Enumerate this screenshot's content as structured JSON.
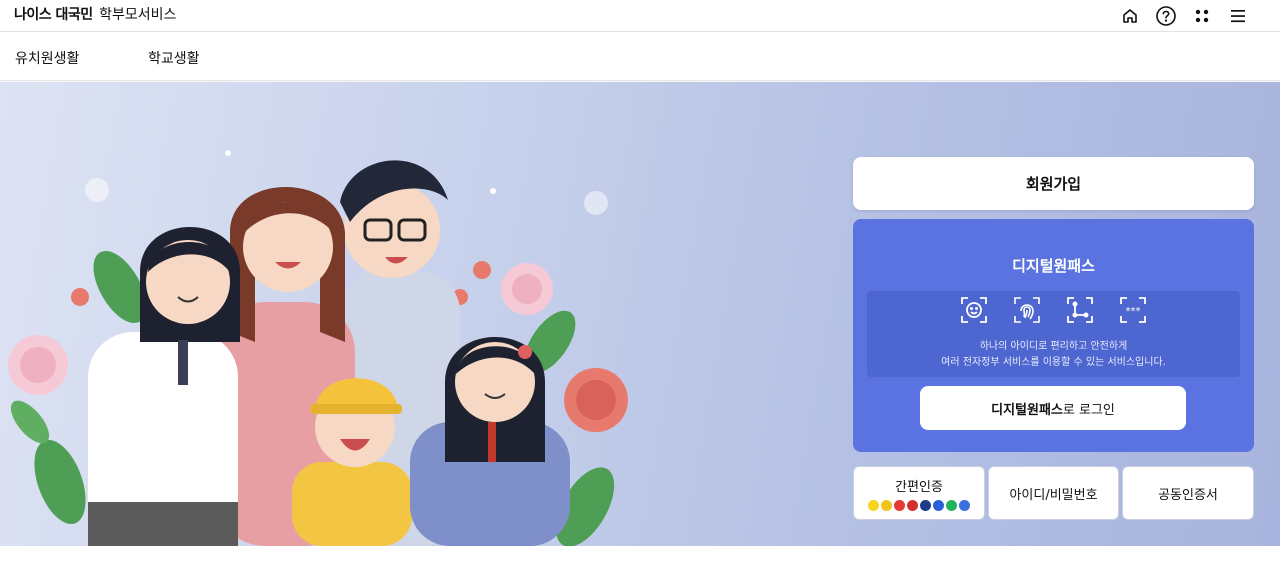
{
  "header": {
    "brand_bold": "나이스 대국민",
    "brand_light": "학부모서비스",
    "icons": [
      "home-icon",
      "help-icon",
      "apps-icon",
      "menu-icon"
    ]
  },
  "nav": {
    "items": [
      {
        "label": "유치원생활"
      },
      {
        "label": "학교생활"
      }
    ]
  },
  "panel": {
    "signup_label": "회원가입",
    "digital_pass": {
      "title": "디지털원패스",
      "icons": [
        "face-icon",
        "fingerprint-icon",
        "pattern-icon",
        "pin-icon"
      ],
      "desc_line1": "하나의 아이디로 편리하고 안전하게",
      "desc_line2": "여러 전자정부 서비스를 이용할 수 있는 서비스입니다.",
      "login_bold": "디지털원패스",
      "login_rest": "로 로그인"
    },
    "auth": {
      "simple_label": "간편인증",
      "id_label": "아이디/비밀번호",
      "cert_label": "공동인증서",
      "simple_logo_colors": [
        "#f7d51d",
        "#f0c419",
        "#e53935",
        "#d32f2f",
        "#1e3a8a",
        "#2b5fd9",
        "#22b35a",
        "#3b6fe0"
      ]
    }
  },
  "colors": {
    "accent": "#5a73e0",
    "accent_dark": "#4e66cf",
    "hero_bg": "#b3bfe3"
  }
}
